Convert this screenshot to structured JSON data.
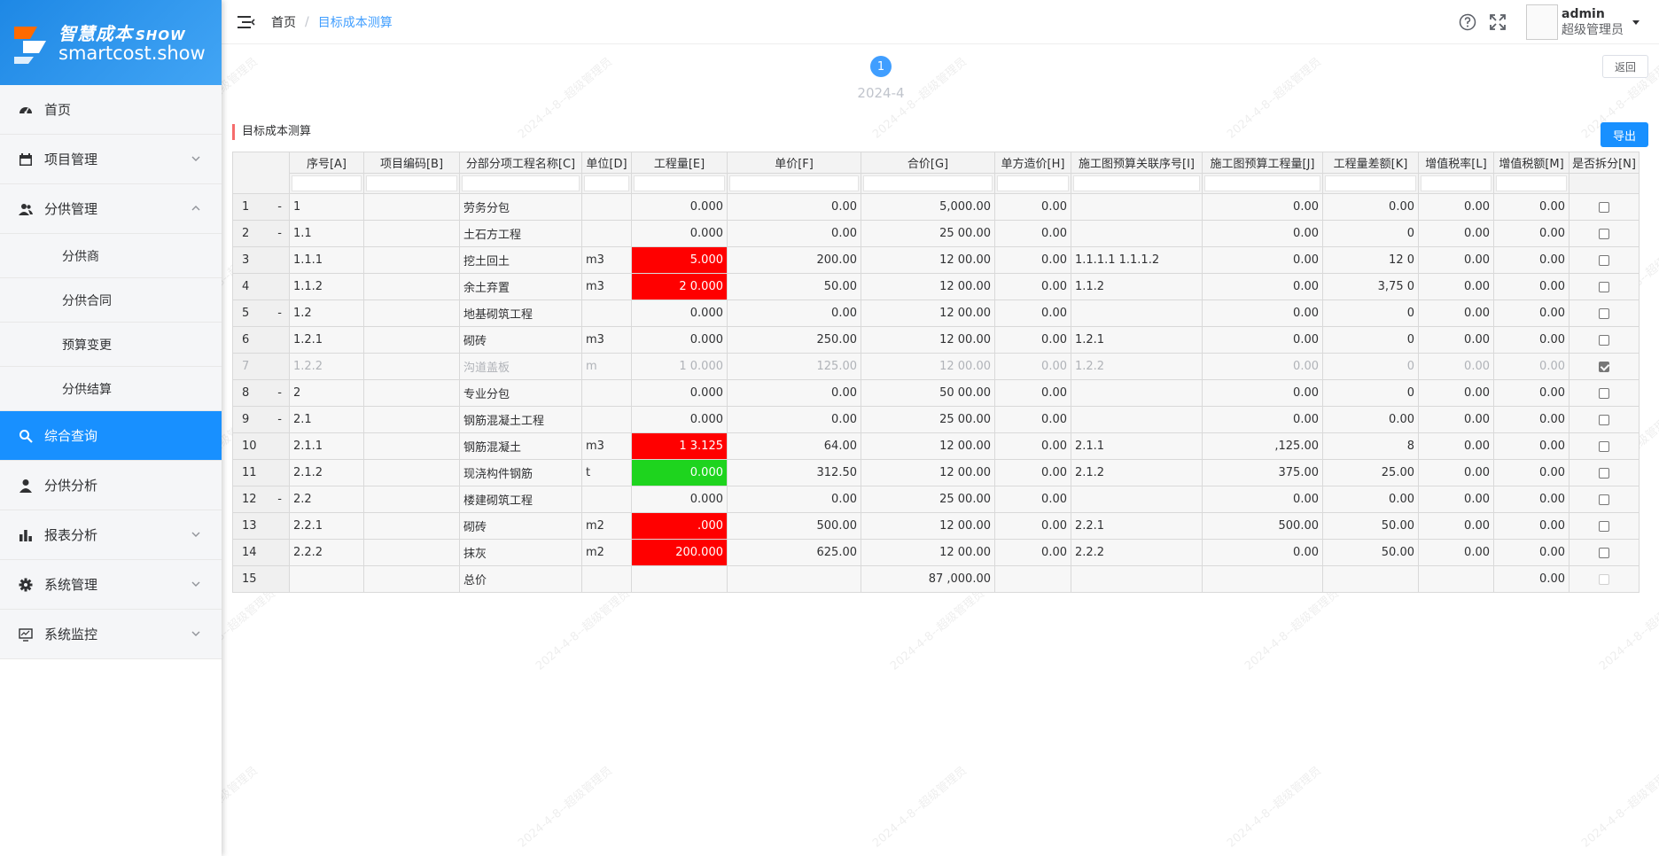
{
  "brand": {
    "title_cn": "智慧成本",
    "title_suffix": "SHOW",
    "subtitle": "smartcost.show"
  },
  "sidebar": {
    "items": [
      {
        "label": "首页",
        "icon": "dashboard-icon"
      },
      {
        "label": "项目管理",
        "icon": "calendar-icon"
      },
      {
        "label": "分供管理",
        "icon": "users-icon",
        "expanded": true
      },
      {
        "label": "综合查询",
        "icon": "search-icon",
        "active": true
      },
      {
        "label": "分供分析",
        "icon": "user-icon"
      },
      {
        "label": "报表分析",
        "icon": "bar-chart-icon"
      },
      {
        "label": "系统管理",
        "icon": "gear-icon"
      },
      {
        "label": "系统监控",
        "icon": "monitor-icon"
      }
    ],
    "subitems": [
      "分供商",
      "分供合同",
      "预算变更",
      "分供结算"
    ]
  },
  "header": {
    "breadcrumb": [
      "首页",
      "目标成本测算"
    ],
    "user_name": "admin",
    "user_role": "超级管理员"
  },
  "main": {
    "step_number": "1",
    "step_label": "2024-4",
    "back_label": "返回",
    "export_label": "导出",
    "section_title": "目标成本测算"
  },
  "watermark_text": "2024-4-8--超级管理员",
  "table": {
    "columns": [
      "序号[A]",
      "项目编码[B]",
      "分部分项工程名称[C]",
      "单位[D]",
      "工程量[E]",
      "单价[F]",
      "合价[G]",
      "单方造价[H]",
      "施工图预算关联序号[I]",
      "施工图预算工程量[J]",
      "工程量差额[K]",
      "增值税率[L]",
      "增值税额[M]",
      "是否拆分[N]"
    ],
    "rows": [
      {
        "no": "1",
        "toggle": "-",
        "a": "1",
        "b": "",
        "c": "劳务分包",
        "d": "",
        "e": "0.000",
        "f": "0.00",
        "g": "5,000.00",
        "h": "0.00",
        "i": "",
        "j": "0.00",
        "k": "0.00",
        "l": "0.00",
        "m": "0.00",
        "n": "unchecked"
      },
      {
        "no": "2",
        "toggle": "-",
        "a": "1.1",
        "b": "",
        "c": "土石方工程",
        "d": "",
        "e": "0.000",
        "f": "0.00",
        "g": "25 00.00",
        "h": "0.00",
        "i": "",
        "j": "0.00",
        "k": "0",
        "l": "0.00",
        "m": "0.00",
        "n": "unchecked"
      },
      {
        "no": "3",
        "toggle": "",
        "a": "1.1.1",
        "b": "",
        "c": "挖土回土",
        "d": "m3",
        "e": "5.000",
        "f": "200.00",
        "g": "12 00.00",
        "h": "0.00",
        "i": "1.1.1.1 1.1.1.2",
        "j": "0.00",
        "k": "12 0",
        "l": "0.00",
        "m": "0.00",
        "n": "unchecked",
        "e_color": "red"
      },
      {
        "no": "4",
        "toggle": "",
        "a": "1.1.2",
        "b": "",
        "c": "余土弃置",
        "d": "m3",
        "e": "2 0.000",
        "f": "50.00",
        "g": "12 00.00",
        "h": "0.00",
        "i": "1.1.2",
        "j": "0.00",
        "k": "3,75 0",
        "l": "0.00",
        "m": "0.00",
        "n": "unchecked",
        "e_color": "red"
      },
      {
        "no": "5",
        "toggle": "-",
        "a": "1.2",
        "b": "",
        "c": "地基砌筑工程",
        "d": "",
        "e": "0.000",
        "f": "0.00",
        "g": "12 00.00",
        "h": "0.00",
        "i": "",
        "j": "0.00",
        "k": "0",
        "l": "0.00",
        "m": "0.00",
        "n": "unchecked"
      },
      {
        "no": "6",
        "toggle": "",
        "a": "1.2.1",
        "b": "",
        "c": "砌砖",
        "d": "m3",
        "e": "0.000",
        "f": "250.00",
        "g": "12 00.00",
        "h": "0.00",
        "i": "1.2.1",
        "j": "0.00",
        "k": "0",
        "l": "0.00",
        "m": "0.00",
        "n": "unchecked"
      },
      {
        "no": "7",
        "toggle": "",
        "a": "1.2.2",
        "b": "",
        "c": "沟道盖板",
        "d": "m",
        "e": "1 0.000",
        "f": "125.00",
        "g": "12 00.00",
        "h": "0.00",
        "i": "1.2.2",
        "j": "0.00",
        "k": "0",
        "l": "0.00",
        "m": "0.00",
        "n": "checked",
        "dim": true
      },
      {
        "no": "8",
        "toggle": "-",
        "a": "2",
        "b": "",
        "c": "专业分包",
        "d": "",
        "e": "0.000",
        "f": "0.00",
        "g": "50 00.00",
        "h": "0.00",
        "i": "",
        "j": "0.00",
        "k": "0",
        "l": "0.00",
        "m": "0.00",
        "n": "unchecked"
      },
      {
        "no": "9",
        "toggle": "-",
        "a": "2.1",
        "b": "",
        "c": "钢筋混凝土工程",
        "d": "",
        "e": "0.000",
        "f": "0.00",
        "g": "25 00.00",
        "h": "0.00",
        "i": "",
        "j": "0.00",
        "k": "0.00",
        "l": "0.00",
        "m": "0.00",
        "n": "unchecked"
      },
      {
        "no": "10",
        "toggle": "",
        "a": "2.1.1",
        "b": "",
        "c": "钢筋混凝土",
        "d": "m3",
        "e": "1 3.125",
        "f": "64.00",
        "g": "12 00.00",
        "h": "0.00",
        "i": "2.1.1",
        "j": ",125.00",
        "k": "8",
        "l": "0.00",
        "m": "0.00",
        "n": "unchecked",
        "e_color": "red"
      },
      {
        "no": "11",
        "toggle": "",
        "a": "2.1.2",
        "b": "",
        "c": "现浇构件钢筋",
        "d": "t",
        "e": "0.000",
        "f": "312.50",
        "g": "12 00.00",
        "h": "0.00",
        "i": "2.1.2",
        "j": "375.00",
        "k": "25.00",
        "l": "0.00",
        "m": "0.00",
        "n": "unchecked",
        "e_color": "green"
      },
      {
        "no": "12",
        "toggle": "-",
        "a": "2.2",
        "b": "",
        "c": "楼建砌筑工程",
        "d": "",
        "e": "0.000",
        "f": "0.00",
        "g": "25 00.00",
        "h": "0.00",
        "i": "",
        "j": "0.00",
        "k": "0.00",
        "l": "0.00",
        "m": "0.00",
        "n": "unchecked"
      },
      {
        "no": "13",
        "toggle": "",
        "a": "2.2.1",
        "b": "",
        "c": "砌砖",
        "d": "m2",
        "e": ".000",
        "f": "500.00",
        "g": "12 00.00",
        "h": "0.00",
        "i": "2.2.1",
        "j": "500.00",
        "k": "50.00",
        "l": "0.00",
        "m": "0.00",
        "n": "unchecked",
        "e_color": "red"
      },
      {
        "no": "14",
        "toggle": "",
        "a": "2.2.2",
        "b": "",
        "c": "抹灰",
        "d": "m2",
        "e": "200.000",
        "f": "625.00",
        "g": "12 00.00",
        "h": "0.00",
        "i": "2.2.2",
        "j": "0.00",
        "k": "50.00",
        "l": "0.00",
        "m": "0.00",
        "n": "unchecked",
        "e_color": "red"
      },
      {
        "no": "15",
        "toggle": "",
        "a": "",
        "b": "",
        "c": "总价",
        "d": "",
        "e": "",
        "f": "",
        "g": "87 ,000.00",
        "h": "",
        "i": "",
        "j": "",
        "k": "",
        "l": "",
        "m": "0.00",
        "n": "disabled"
      }
    ]
  }
}
